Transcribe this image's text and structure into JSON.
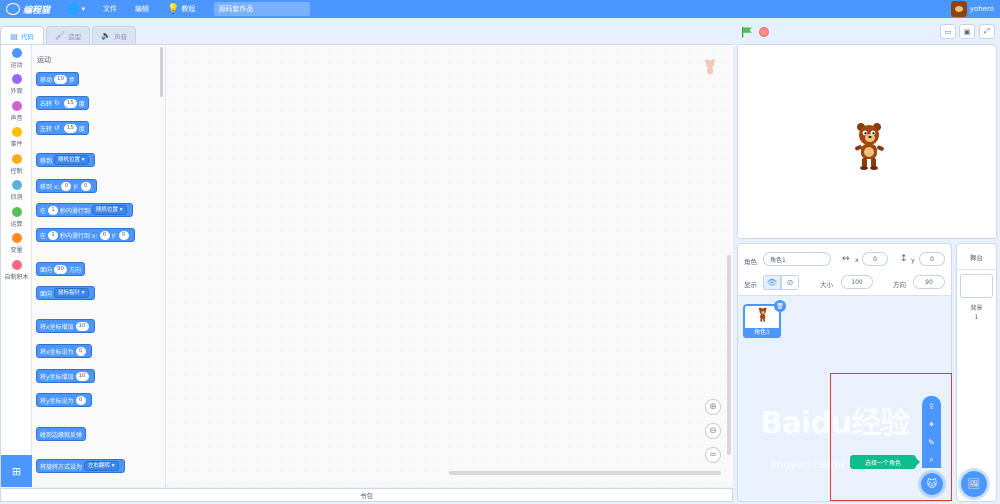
{
  "menubar": {
    "logo_text": "编程猫",
    "items": [
      {
        "icon": "globe-icon",
        "label": ""
      },
      {
        "icon": "",
        "label": "文件"
      },
      {
        "icon": "",
        "label": "编辑"
      },
      {
        "icon": "lightbulb-icon",
        "label": "教程"
      }
    ],
    "project_title": "源码套作品",
    "username": "yohero"
  },
  "tabs": [
    {
      "label": "代码",
      "icon": "code-icon",
      "active": true
    },
    {
      "label": "造型",
      "icon": "brush-icon",
      "active": false
    },
    {
      "label": "声音",
      "icon": "speaker-icon",
      "active": false
    }
  ],
  "categories": [
    {
      "label": "运动",
      "color": "#4c97ff"
    },
    {
      "label": "外观",
      "color": "#9966ff"
    },
    {
      "label": "声音",
      "color": "#cf63cf"
    },
    {
      "label": "事件",
      "color": "#ffbf00"
    },
    {
      "label": "控制",
      "color": "#ffab19"
    },
    {
      "label": "侦测",
      "color": "#5cb1d6"
    },
    {
      "label": "运算",
      "color": "#59c059"
    },
    {
      "label": "变量",
      "color": "#ff8c1a"
    },
    {
      "label": "自制积木",
      "color": "#ff6680"
    }
  ],
  "palette": {
    "section_title": "运动",
    "blocks": {
      "move": {
        "a": "移动",
        "v": "10",
        "b": "步"
      },
      "turn_right": {
        "a": "右转",
        "v": "15",
        "b": "度"
      },
      "turn_left": {
        "a": "左转",
        "v": "15",
        "b": "度"
      },
      "goto": {
        "a": "移到",
        "d": "随机位置"
      },
      "goto_xy": {
        "a": "移到 x:",
        "x": "0",
        "y_label": "y:",
        "y": "0"
      },
      "glide": {
        "a": "在",
        "v": "1",
        "b": "秒内滑行到",
        "d": "随机位置"
      },
      "glide_xy": {
        "a": "在",
        "v": "1",
        "b": "秒内滑行到 x:",
        "x": "0",
        "y_label": "y:",
        "y": "0"
      },
      "point_dir": {
        "a": "面向",
        "v": "90",
        "b": "方向"
      },
      "point_towards": {
        "a": "面向",
        "d": "鼠标指针"
      },
      "change_x": {
        "a": "将x坐标增加",
        "v": "10"
      },
      "set_x": {
        "a": "将x坐标设为",
        "v": "0"
      },
      "change_y": {
        "a": "将y坐标增加",
        "v": "10"
      },
      "set_y": {
        "a": "将y坐标设为",
        "v": "0"
      },
      "bounce": {
        "a": "碰到边缘就反弹"
      },
      "rotation": {
        "a": "将旋转方式设为",
        "d": "左右翻转"
      }
    }
  },
  "backpack_label": "书包",
  "sprite_info": {
    "sprite_label": "角色",
    "sprite_name": "角色1",
    "x_label": "x",
    "x_value": "0",
    "y_label": "y",
    "y_value": "0",
    "show_label": "显示",
    "size_label": "大小",
    "size_value": "100",
    "direction_label": "方向",
    "direction_value": "90"
  },
  "sprites": [
    {
      "name": "角色1",
      "selected": true
    }
  ],
  "add_sprite_tooltip": "选择一个角色",
  "stage_selector": {
    "title": "舞台",
    "backdrop_label": "背景",
    "backdrop_count": "1"
  },
  "watermark": {
    "main": "Baidu经验",
    "sub": "jingyan.baidu.com"
  },
  "colors": {
    "accent": "#4c97ff",
    "tooltip": "#0fbd8c",
    "highlight": "#e43b3b"
  }
}
